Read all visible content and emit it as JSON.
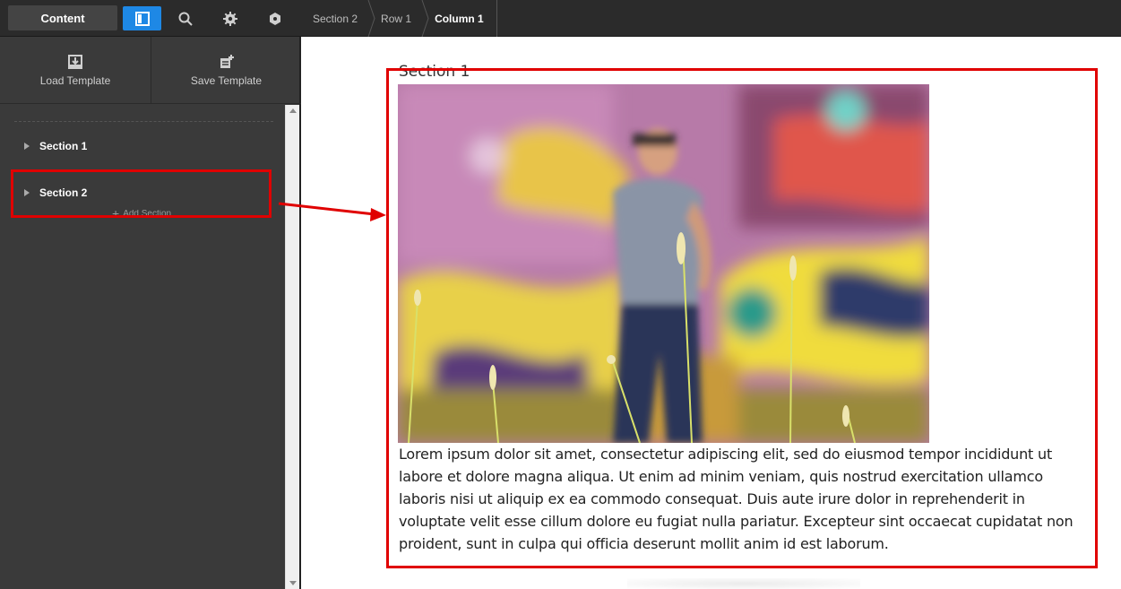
{
  "topbar": {
    "content_label": "Content",
    "icons": [
      "panel-toggle-icon",
      "search-icon",
      "gear-icon",
      "hexagon-icon"
    ]
  },
  "breadcrumbs": [
    "Section 2",
    "Row 1",
    "Column 1"
  ],
  "left_panel": {
    "load_template": "Load Template",
    "save_template": "Save Template",
    "sections": [
      "Section 1",
      "Section 2"
    ],
    "add_section": "Add Section"
  },
  "canvas": {
    "section_label": "Section 1",
    "body_text": "Lorem ipsum dolor sit amet, consectetur adipiscing elit, sed do eiusmod tempor incididunt ut labore et dolore magna aliqua. Ut enim ad minim veniam, quis nostrud exercitation ullamco laboris nisi ut aliquip ex ea commodo consequat. Duis aute irure dolor in reprehenderit in voluptate velit esse cillum dolore eu fugiat nulla pariatur. Excepteur sint occaecat cupidatat non proident, sunt in culpa qui officia deserunt mollit anim id est laborum."
  },
  "colors": {
    "accent": "#1e88e5",
    "annotation": "#e00000",
    "topbar_bg": "#2b2b2b",
    "panel_bg": "#3a3a3a"
  }
}
